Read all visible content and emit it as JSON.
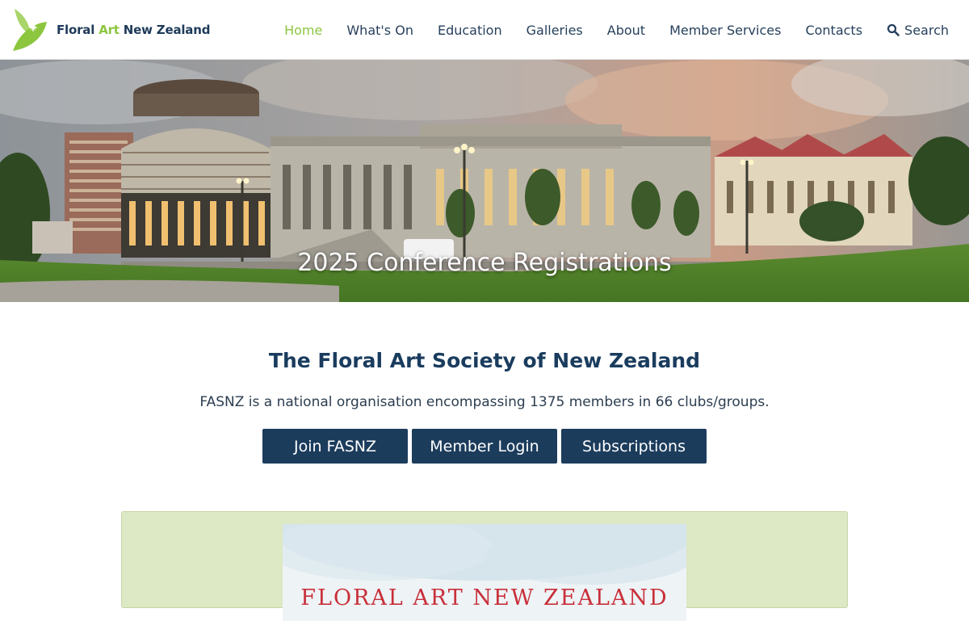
{
  "site": {
    "logo_parts": {
      "a": "Floral ",
      "b": "Art",
      "c": " New Zealand"
    }
  },
  "nav": {
    "items": [
      "Home",
      "What's On",
      "Education",
      "Galleries",
      "About",
      "Member Services",
      "Contacts"
    ],
    "search_label": "Search",
    "active_color": "#8cc63f",
    "text_color": "#27405c"
  },
  "hero": {
    "caption": "2025 Conference Registrations"
  },
  "intro": {
    "title": "The Floral Art Society of New Zealand",
    "text": "FASNZ is a national organisation encompassing 1375 members in 66 clubs/groups."
  },
  "buttons": {
    "join": "Join FASNZ",
    "login": "Member Login",
    "subscriptions": "Subscriptions",
    "color": "#1c3c5c"
  },
  "feature": {
    "poster_title": "FLORAL ART NEW ZEALAND",
    "panel_color": "#dde8c4"
  },
  "icons": {
    "logo": "leaf-star-icon",
    "search": "search-icon"
  }
}
